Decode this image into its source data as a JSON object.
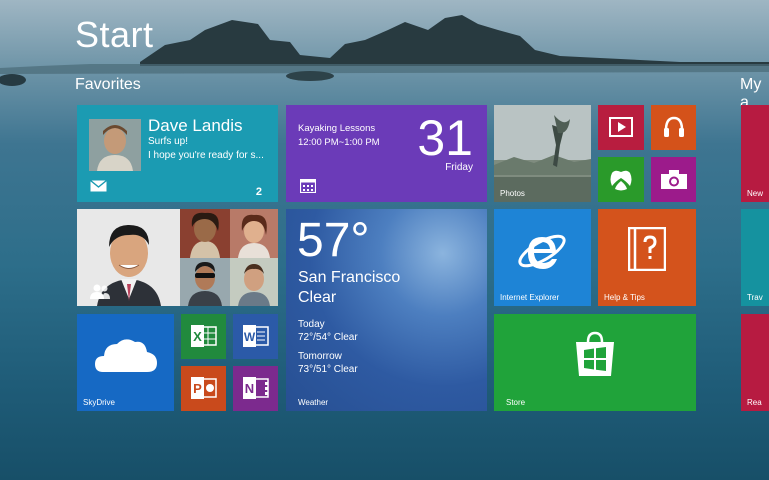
{
  "screen": {
    "title": "Start"
  },
  "groups": {
    "favorites": "Favorites",
    "my_apps": "My a"
  },
  "mail": {
    "sender": "Dave Landis",
    "subject": "Surfs up!",
    "preview": "I hope you're ready for s...",
    "count": "2",
    "icon": "mail-icon"
  },
  "calendar": {
    "event": "Kayaking Lessons",
    "time": "12:00 PM~1:00 PM",
    "day_number": "31",
    "weekday": "Friday",
    "icon": "calendar-icon"
  },
  "photos": {
    "label": "Photos"
  },
  "small_tiles": {
    "video": "video-icon",
    "music": "headphones-icon",
    "games": "xbox-icon",
    "camera": "camera-icon"
  },
  "people": {
    "icon": "people-icon"
  },
  "weather": {
    "temperature": "57°",
    "city": "San Francisco",
    "condition": "Clear",
    "today_label": "Today",
    "today_range": "72°/54° Clear",
    "tomorrow_label": "Tomorrow",
    "tomorrow_range": "73°/51° Clear",
    "label": "Weather"
  },
  "ie": {
    "label": "Internet Explorer"
  },
  "help": {
    "label": "Help & Tips"
  },
  "skydrive": {
    "label": "SkyDrive"
  },
  "office": {
    "excel": "X",
    "word": "W",
    "powerpoint": "P",
    "onenote": "N"
  },
  "store": {
    "label": "Store"
  },
  "right_column": {
    "top": "New",
    "middle": "Trav",
    "bottom": "Rea"
  },
  "colors": {
    "mail": "#1b9bb2",
    "calendar": "#6b3bb8",
    "video": "#b81d3f",
    "music": "#d4521a",
    "games": "#2a9a2a",
    "camera": "#9c1b8b",
    "ie": "#1e84d6",
    "help": "#d4531c",
    "skydrive": "#1669c4",
    "excel": "#218a3d",
    "word": "#2b5aa8",
    "powerpoint": "#c94a1c",
    "onenote": "#7c2a8e",
    "store": "#20a33a",
    "right_red": "#b71b41",
    "right_teal": "#15929f"
  }
}
